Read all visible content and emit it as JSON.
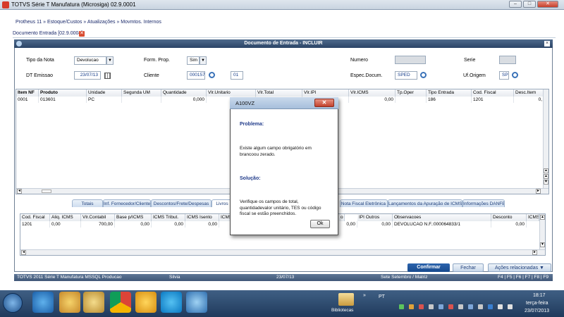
{
  "window": {
    "title": "TOTVS Série T Manufatura (Microsiga) 02.9.0001"
  },
  "breadcrumb": "Protheus 11 » Estoque/Custos » Atualizações » Movmtos. Internos",
  "doc_tab": "Documento Entrada [02.9.0004]",
  "dialog": {
    "title": "Documento de Entrada - INCLUIR"
  },
  "header": {
    "tipo_nota_label": "Tipo da Nota",
    "tipo_nota_value": "Devolucao",
    "form_prop_label": "Form. Prop.",
    "form_prop_value": "Sim",
    "numero_label": "Numero",
    "serie_label": "Serie",
    "dt_emissao_label": "DT Emissao",
    "dt_emissao_value": "23/07/13",
    "cliente_label": "Cliente",
    "cliente_value": "000157",
    "loja_value": "01",
    "espec_label": "Espec.Docum.",
    "espec_value": "SPED",
    "uf_label": "Uf.Origem",
    "uf_value": "SP"
  },
  "items_grid": {
    "columns": [
      "Item NF",
      "Produto",
      "Unidade",
      "Segunda UM",
      "Quantidade",
      "Vlr.Unitario",
      "Vlr.Total",
      "Vlr.IPI",
      "Vlr.ICMS",
      "Tp.Oper",
      "Tipo Entrada",
      "Cod. Fiscal",
      "Desc.Item"
    ],
    "row": [
      "0001",
      "013601",
      "PC",
      "",
      "0,000",
      "",
      "",
      "",
      "0,00",
      "",
      "186",
      "1201",
      "0,"
    ]
  },
  "folders": [
    "Totais",
    "Inf. Fornecedor/Cliente",
    "Descontos/Frete/Despesas",
    "Livros",
    "Nota Fiscal Eletrônica",
    "Lançamentos da Apuração de ICMS",
    "Informações DANFE"
  ],
  "books_grid": {
    "columns": [
      "Cod. Fiscal",
      "Aliq. ICMS",
      "Vlr.Contabil",
      "Base p/ICMS",
      "ICMS Tribut.",
      "ICMS Isento",
      "ICMS",
      "IPI Outros",
      "Observacoes",
      "Desconto",
      "ICMS"
    ],
    "row": [
      "1201",
      "0,00",
      "700,00",
      "0,00",
      "0,00",
      "0,00",
      "0,00",
      "0,00",
      "DEVOLUCAO N.F.:000064833/1",
      "0,00",
      ""
    ],
    "partial_col": "o"
  },
  "buttons": {
    "confirm": "Confirmar",
    "cancel": "Fechar",
    "actions": "Ações relacionadas"
  },
  "statusbar": {
    "left": "TOTVS 2011 Série T Manufatura MSSQL Producao",
    "user": "Silvia",
    "date": "23/07/13",
    "branch": "Sete Setembro / Matriz",
    "keys": "F4 | F5 | F6 | F7 | F8 | F9"
  },
  "modal": {
    "title": "A100VZ",
    "problem_title": "Problema:",
    "problem_text": "Existe algum campo obrigatório em brancoou zerado.",
    "solution_title": "Solução:",
    "solution_text": "Verifique os campos de total, quantidadevalor unitário, TES ou código fiscal se estão preenchidos.",
    "ok": "Ok"
  },
  "taskbar": {
    "library": "Bibliotecas",
    "lang": "PT",
    "time": "18:17",
    "day": "terça-feira",
    "date": "23/07/2013"
  },
  "colors": {
    "accent": "#1f3f7a",
    "confirm_bg": "#1d4f96",
    "close_red": "#c7402b"
  }
}
